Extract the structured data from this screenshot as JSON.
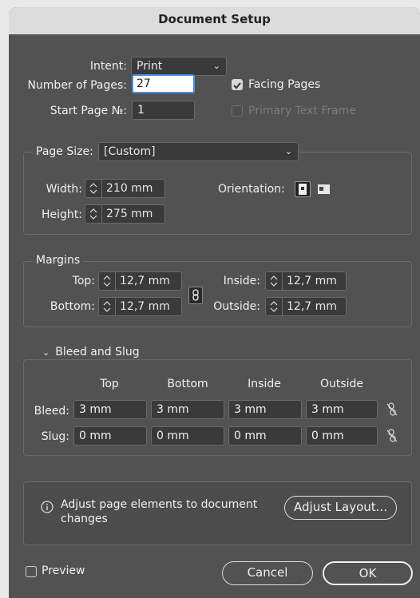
{
  "window": {
    "title": "Document Setup"
  },
  "intent": {
    "label": "Intent:",
    "value": "Print"
  },
  "pages": {
    "number_label": "Number of Pages:",
    "number_value": "27",
    "start_label": "Start Page №:",
    "start_value": "1",
    "facing_label": "Facing Pages",
    "facing_checked": true,
    "primary_label": "Primary Text Frame",
    "primary_checked": false
  },
  "page_size": {
    "label": "Page Size:",
    "value": "[Custom]",
    "width_label": "Width:",
    "width_value": "210 mm",
    "height_label": "Height:",
    "height_value": "275 mm",
    "orientation_label": "Orientation:"
  },
  "margins": {
    "title": "Margins",
    "top_label": "Top:",
    "top_value": "12,7 mm",
    "bottom_label": "Bottom:",
    "bottom_value": "12,7 mm",
    "inside_label": "Inside:",
    "inside_value": "12,7 mm",
    "outside_label": "Outside:",
    "outside_value": "12,7 mm"
  },
  "bleed_slug": {
    "title": "Bleed and Slug",
    "headers": [
      "Top",
      "Bottom",
      "Inside",
      "Outside"
    ],
    "bleed_label": "Bleed:",
    "bleed_values": [
      "3 mm",
      "3 mm",
      "3 mm",
      "3 mm"
    ],
    "slug_label": "Slug:",
    "slug_values": [
      "0 mm",
      "0 mm",
      "0 mm",
      "0 mm"
    ]
  },
  "adjust": {
    "message": "Adjust page elements to document changes",
    "button": "Adjust Layout..."
  },
  "footer": {
    "preview_label": "Preview",
    "preview_checked": false,
    "cancel": "Cancel",
    "ok": "OK"
  }
}
